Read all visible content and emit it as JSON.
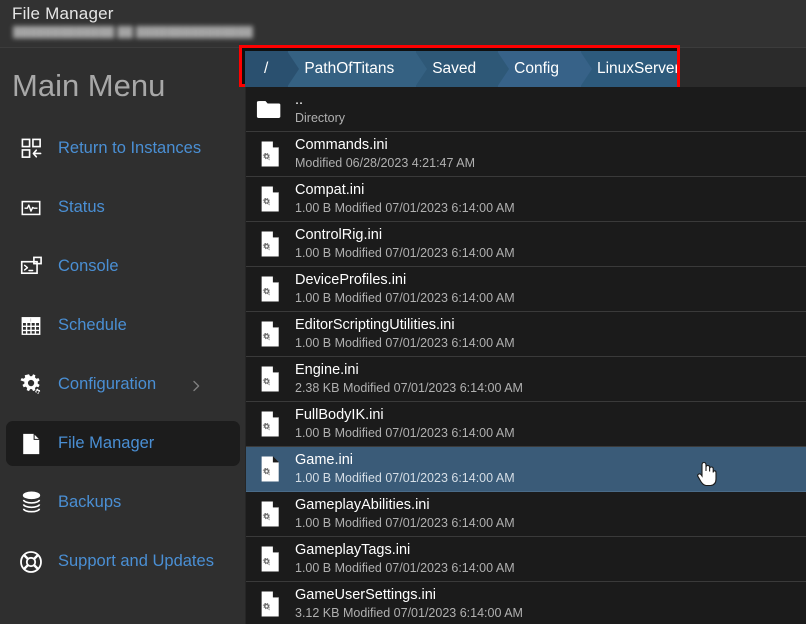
{
  "header": {
    "title": "File Manager",
    "subtitle_redacted": "█████████████ ██ ███████████████"
  },
  "sidebar": {
    "heading": "Main Menu",
    "items": [
      {
        "label": "Return to Instances",
        "icon": "grid-arrow-icon",
        "active": false,
        "chevron": false
      },
      {
        "label": "Status",
        "icon": "pulse-icon",
        "active": false,
        "chevron": false
      },
      {
        "label": "Console",
        "icon": "terminal-icon",
        "active": false,
        "chevron": false
      },
      {
        "label": "Schedule",
        "icon": "calendar-grid-icon",
        "active": false,
        "chevron": false
      },
      {
        "label": "Configuration",
        "icon": "gear-icon",
        "active": false,
        "chevron": true
      },
      {
        "label": "File Manager",
        "icon": "document-icon",
        "active": true,
        "chevron": false
      },
      {
        "label": "Backups",
        "icon": "database-icon",
        "active": false,
        "chevron": false
      },
      {
        "label": "Support and Updates",
        "icon": "lifebuoy-icon",
        "active": false,
        "chevron": false
      }
    ]
  },
  "breadcrumb": {
    "highlight_color": "#ff0000",
    "items": [
      {
        "label": "/"
      },
      {
        "label": "PathOfTitans"
      },
      {
        "label": "Saved"
      },
      {
        "label": "Config"
      },
      {
        "label": "LinuxServer"
      }
    ]
  },
  "filelist": {
    "selected_color": "#3a5b78",
    "rows": [
      {
        "name": "..",
        "meta": "Directory",
        "icon": "folder-icon",
        "selected": false
      },
      {
        "name": "Commands.ini",
        "meta": "Modified 06/28/2023 4:21:47 AM",
        "icon": "ini-file-icon",
        "selected": false
      },
      {
        "name": "Compat.ini",
        "meta": "1.00 B Modified 07/01/2023 6:14:00 AM",
        "icon": "ini-file-icon",
        "selected": false
      },
      {
        "name": "ControlRig.ini",
        "meta": "1.00 B Modified 07/01/2023 6:14:00 AM",
        "icon": "ini-file-icon",
        "selected": false
      },
      {
        "name": "DeviceProfiles.ini",
        "meta": "1.00 B Modified 07/01/2023 6:14:00 AM",
        "icon": "ini-file-icon",
        "selected": false
      },
      {
        "name": "EditorScriptingUtilities.ini",
        "meta": "1.00 B Modified 07/01/2023 6:14:00 AM",
        "icon": "ini-file-icon",
        "selected": false
      },
      {
        "name": "Engine.ini",
        "meta": "2.38 KB Modified 07/01/2023 6:14:00 AM",
        "icon": "ini-file-icon",
        "selected": false
      },
      {
        "name": "FullBodyIK.ini",
        "meta": "1.00 B Modified 07/01/2023 6:14:00 AM",
        "icon": "ini-file-icon",
        "selected": false
      },
      {
        "name": "Game.ini",
        "meta": "1.00 B Modified 07/01/2023 6:14:00 AM",
        "icon": "ini-file-icon",
        "selected": true
      },
      {
        "name": "GameplayAbilities.ini",
        "meta": "1.00 B Modified 07/01/2023 6:14:00 AM",
        "icon": "ini-file-icon",
        "selected": false
      },
      {
        "name": "GameplayTags.ini",
        "meta": "1.00 B Modified 07/01/2023 6:14:00 AM",
        "icon": "ini-file-icon",
        "selected": false
      },
      {
        "name": "GameUserSettings.ini",
        "meta": "3.12 KB Modified 07/01/2023 6:14:00 AM",
        "icon": "ini-file-icon",
        "selected": false
      }
    ]
  }
}
